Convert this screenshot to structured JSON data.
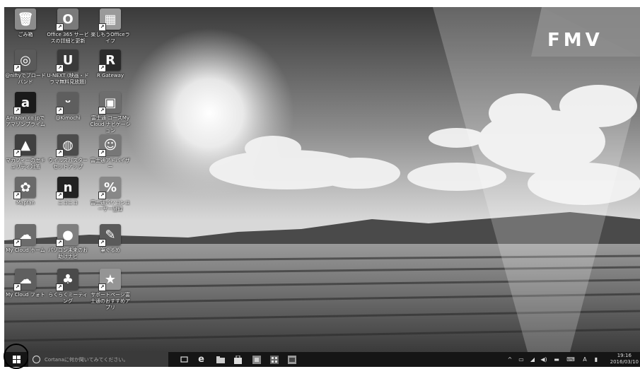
{
  "brand": {
    "logo_text": "FMV"
  },
  "desktop_icons": [
    {
      "id": "recycle",
      "label": "ごみ箱",
      "glyph": "🗑",
      "bg": "#8c8c8c"
    },
    {
      "id": "o365",
      "label": "Office 365 サービスの詳細と更新",
      "glyph": "O",
      "bg": "#7a7a7a"
    },
    {
      "id": "office-life",
      "label": "楽しもうOfficeライフ",
      "glyph": "▦",
      "bg": "#9a9a9a"
    },
    {
      "id": "nifty",
      "label": "@niftyでブロードバンド",
      "glyph": "◎",
      "bg": "#5a5a5a"
    },
    {
      "id": "unext",
      "label": "U-NEXT (映画・ドラマ無料見放題)",
      "glyph": "U",
      "bg": "#3a3a3a"
    },
    {
      "id": "r-gateway",
      "label": "R Gateway",
      "glyph": "R",
      "bg": "#2a2a2a"
    },
    {
      "id": "amazon",
      "label": "Amazon.co.jpでアマゾンプライム",
      "glyph": "a",
      "bg": "#1a1a1a"
    },
    {
      "id": "biglobe",
      "label": "@Kimochi",
      "glyph": "ᵕ",
      "bg": "#5e5e5e"
    },
    {
      "id": "fujitsu-cloud",
      "label": "富士通 コースMy Cloud ナビゲーション",
      "glyph": "▣",
      "bg": "#6e6e6e"
    },
    {
      "id": "security",
      "label": "マカフィーのセキュリティ対策",
      "glyph": "▲",
      "bg": "#404040"
    },
    {
      "id": "trendmicro",
      "label": "ウイルスバスターセットアップ",
      "glyph": "◍",
      "bg": "#4c4c4c"
    },
    {
      "id": "advisor",
      "label": "富士通アドバイザー",
      "glyph": "☺",
      "bg": "#777777"
    },
    {
      "id": "mapion",
      "label": "Mapfan",
      "glyph": "✿",
      "bg": "#6a6a6a"
    },
    {
      "id": "nikoniko",
      "label": "ニコニコ",
      "glyph": "n",
      "bg": "#222222"
    },
    {
      "id": "pc-course",
      "label": "富士通パソコンユーザー登録",
      "glyph": "%",
      "bg": "#888888"
    },
    {
      "id": "mycloud-sync",
      "label": "My Cloud ホーム",
      "glyph": "☁",
      "bg": "#6c6c6c"
    },
    {
      "id": "excite",
      "label": "パソコン未来のお助けナビ",
      "glyph": "●",
      "bg": "#7f7f7f"
    },
    {
      "id": "brush",
      "label": "筆ぐるめ",
      "glyph": "✎",
      "bg": "#5a5a5a"
    },
    {
      "id": "mycloud-photo",
      "label": "My Cloud フォト",
      "glyph": "☁",
      "bg": "#5f5f5f"
    },
    {
      "id": "rakuraku",
      "label": "らくらくミーティング",
      "glyph": "♣",
      "bg": "#4a4a4a"
    },
    {
      "id": "support",
      "label": "サポートページ富士通のおすすめアプリ",
      "glyph": "★",
      "bg": "#959595"
    }
  ],
  "taskbar": {
    "search_placeholder": "Cortanaに何か聞いてみてください。",
    "time": "19:16",
    "date": "2016/03/10"
  },
  "colors": {
    "taskbar": "#151515",
    "search": "#3a3a3a"
  }
}
